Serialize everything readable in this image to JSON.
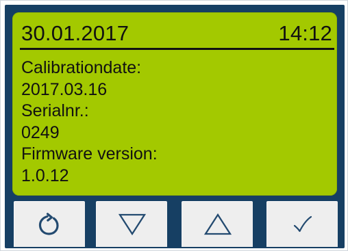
{
  "display": {
    "date": "30.01.2017",
    "time": "14:12",
    "lines": [
      "Calibrationdate:",
      "2017.03.16",
      "Serialnr.:",
      "0249",
      "Firmware version:",
      "1.0.12"
    ]
  },
  "colors": {
    "device_frame": "#163f63",
    "display_background": "#a3c900",
    "display_text": "#111111",
    "button_face": "#eeeeee",
    "icon": "#234a70"
  },
  "buttons": [
    {
      "icon": "refresh-icon"
    },
    {
      "icon": "triangle-down-icon"
    },
    {
      "icon": "triangle-up-icon"
    },
    {
      "icon": "checkmark-icon"
    }
  ]
}
